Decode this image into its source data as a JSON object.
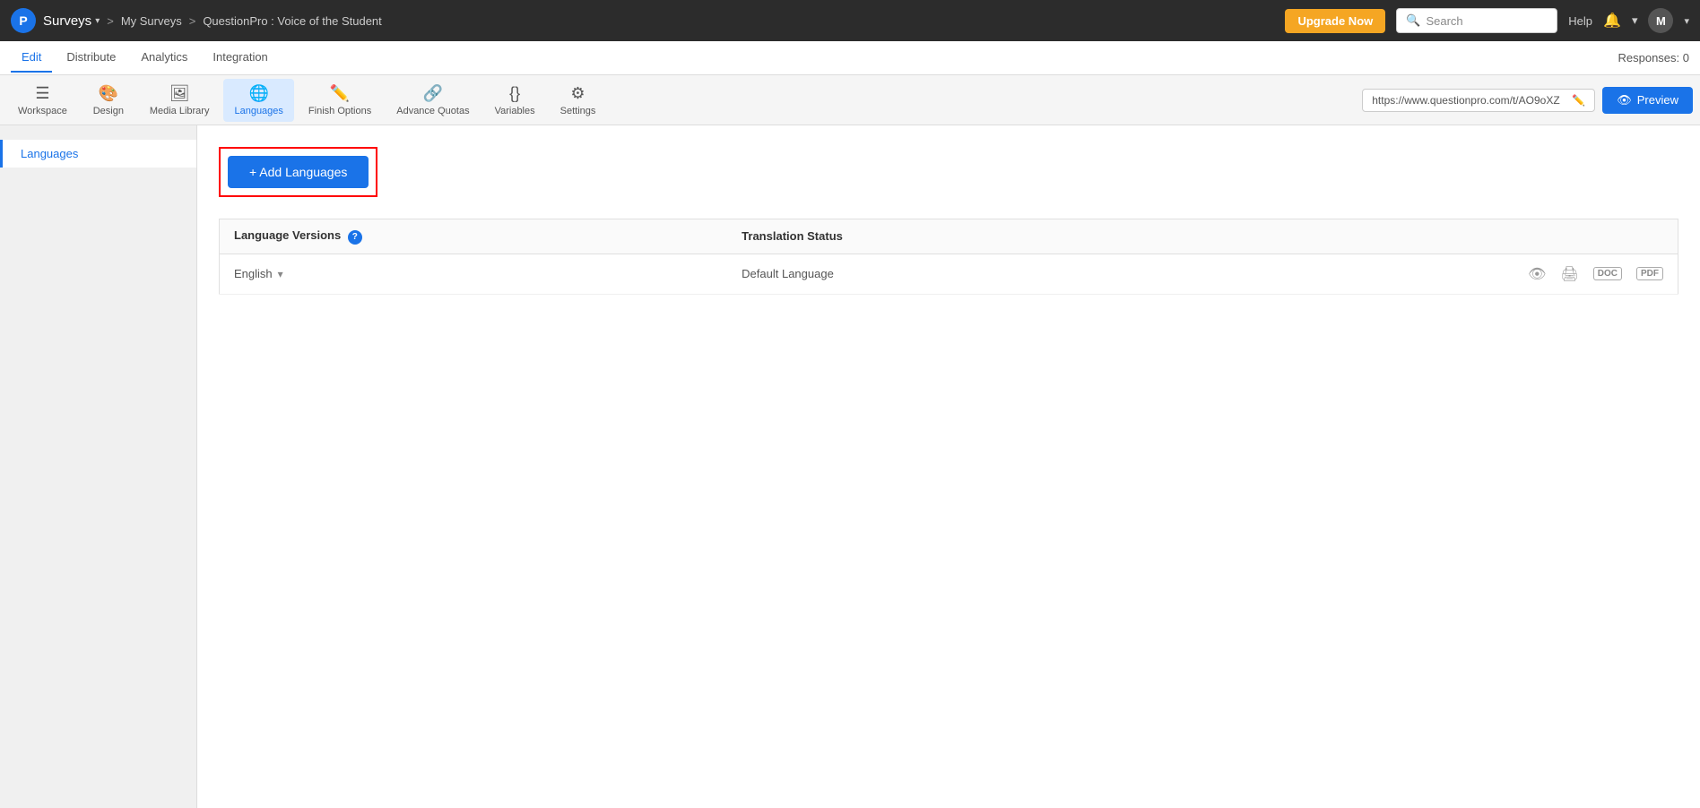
{
  "topNav": {
    "logo": "P",
    "surveys_label": "Surveys",
    "breadcrumb_separator": ">",
    "my_surveys": "My Surveys",
    "survey_title": "QuestionPro : Voice of the Student",
    "upgrade_btn": "Upgrade Now",
    "search_placeholder": "Search",
    "help_label": "Help",
    "user_avatar": "M"
  },
  "secondNav": {
    "items": [
      {
        "label": "Edit",
        "active": true
      },
      {
        "label": "Distribute",
        "active": false
      },
      {
        "label": "Analytics",
        "active": false
      },
      {
        "label": "Integration",
        "active": false
      }
    ],
    "responses_label": "Responses: 0"
  },
  "toolbar": {
    "items": [
      {
        "icon": "☰",
        "label": "Workspace"
      },
      {
        "icon": "🎨",
        "label": "Design"
      },
      {
        "icon": "🖼",
        "label": "Media Library"
      },
      {
        "icon": "🌐",
        "label": "Languages",
        "active": true
      },
      {
        "icon": "✏️",
        "label": "Finish Options"
      },
      {
        "icon": "🔗",
        "label": "Advance Quotas"
      },
      {
        "icon": "{ }",
        "label": "Variables"
      },
      {
        "icon": "⚙",
        "label": "Settings"
      }
    ],
    "url": "https://www.questionpro.com/t/AO9oXZ",
    "preview_btn": "Preview"
  },
  "sidebar": {
    "items": [
      {
        "label": "Languages",
        "active": true
      }
    ]
  },
  "content": {
    "add_languages_btn": "+ Add Languages",
    "table": {
      "headers": [
        {
          "label": "Language Versions",
          "has_info": true
        },
        {
          "label": "Translation Status"
        }
      ],
      "rows": [
        {
          "language": "English",
          "has_dropdown": true,
          "status": "Default Language"
        }
      ]
    }
  }
}
